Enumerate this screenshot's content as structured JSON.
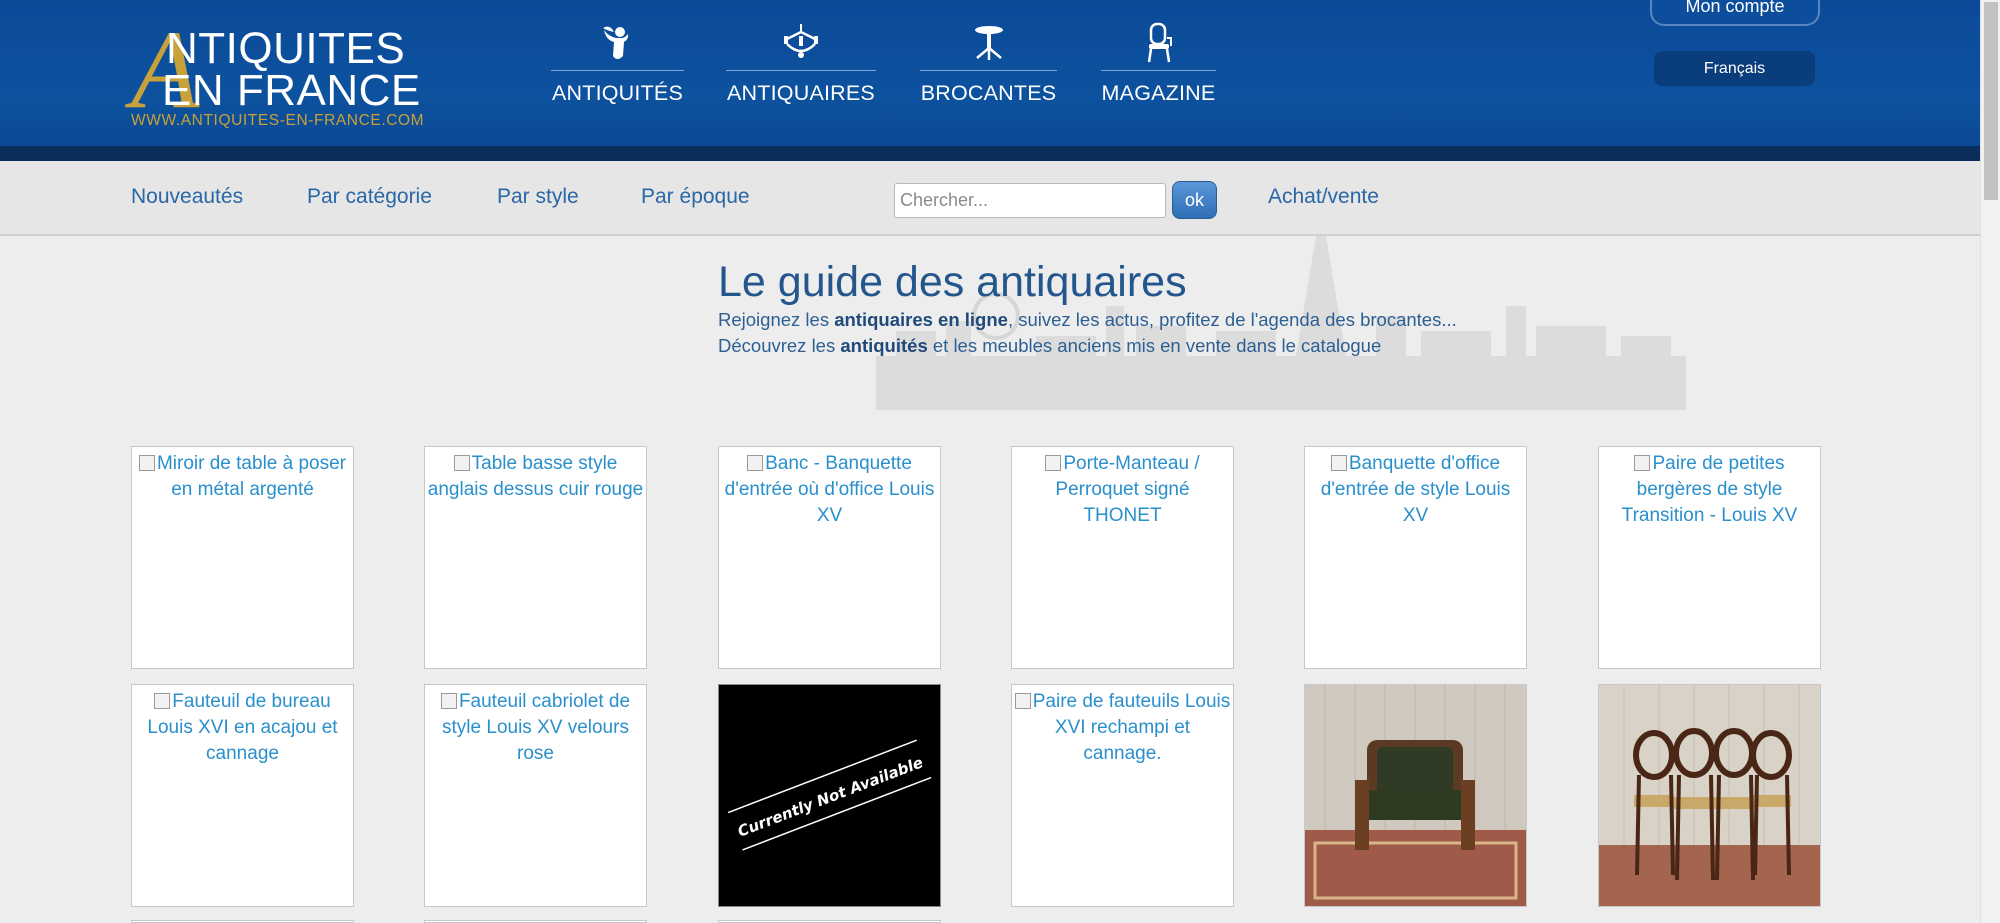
{
  "header": {
    "logo": {
      "letter": "A",
      "line1": "NTIQUITES",
      "line2": "EN FRANCE",
      "url": "WWW.ANTIQUITES-EN-FRANCE.COM"
    },
    "nav": [
      {
        "label": "ANTIQUITÉS",
        "icon": "cherub-icon"
      },
      {
        "label": "ANTIQUAIRES",
        "icon": "chandelier-icon"
      },
      {
        "label": "BROCANTES",
        "icon": "pedestal-table-icon"
      },
      {
        "label": "MAGAZINE",
        "icon": "chair-icon"
      }
    ],
    "account_label": "Mon compte",
    "language_label": "Français"
  },
  "subnav": {
    "links": [
      "Nouveautés",
      "Par catégorie",
      "Par style",
      "Par époque"
    ],
    "search_placeholder": "Chercher...",
    "ok_label": "ok",
    "buy_sell_label": "Achat/vente"
  },
  "hero": {
    "title": "Le guide des antiquaires",
    "line1": {
      "pre": "Rejoignez les ",
      "bold": "antiquaires en ligne",
      "post": ", suivez les actus, profitez de l'agenda des brocantes..."
    },
    "line2": {
      "pre": "Découvrez les ",
      "bold": "antiquités",
      "post": " et les meubles anciens mis en vente dans le catalogue"
    }
  },
  "products": [
    {
      "title": "Miroir de table à poser en métal argenté",
      "state": "broken"
    },
    {
      "title": "Table basse style anglais dessus cuir rouge",
      "state": "broken"
    },
    {
      "title": "Banc - Banquette d'entrée où d'office Louis XV",
      "state": "broken"
    },
    {
      "title": "Porte-Manteau / Perroquet signé THONET",
      "state": "broken"
    },
    {
      "title": "Banquette d'office d'entrée de style Louis XV",
      "state": "broken"
    },
    {
      "title": "Paire de petites bergères de style Transition - Louis XV",
      "state": "broken"
    },
    {
      "title": "Fauteuil de bureau Louis XVI en acajou et cannage",
      "state": "broken"
    },
    {
      "title": "Fauteuil cabriolet de style Louis XV velours rose",
      "state": "broken"
    },
    {
      "title": "Currently Not Available",
      "state": "unavailable"
    },
    {
      "title": "Paire de fauteuils Louis XVI rechampi et cannage.",
      "state": "broken"
    },
    {
      "title": "",
      "state": "photo-armchair"
    },
    {
      "title": "",
      "state": "photo-chairs"
    }
  ]
}
